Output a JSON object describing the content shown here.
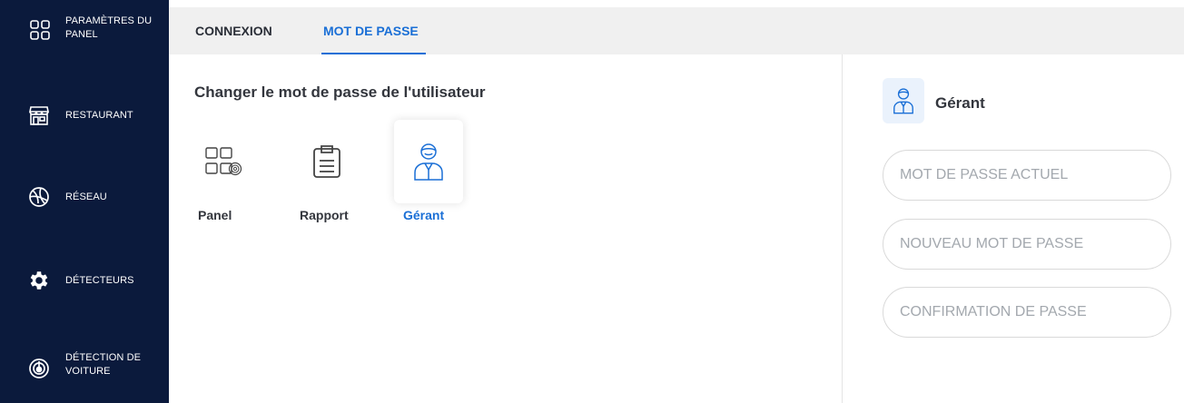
{
  "sidebar": {
    "items": [
      {
        "label": "PARAMÈTRES DU PANEL",
        "icon": "grid-icon"
      },
      {
        "label": "RESTAURANT",
        "icon": "store-icon"
      },
      {
        "label": "RÉSEAU",
        "icon": "globe-icon"
      },
      {
        "label": "DÉTECTEURS",
        "icon": "gear-icon"
      },
      {
        "label": "DÉTECTION DE VOITURE",
        "icon": "radar-icon"
      }
    ]
  },
  "tabs": [
    {
      "label": "CONNEXION",
      "active": false
    },
    {
      "label": "MOT DE PASSE",
      "active": true
    }
  ],
  "main": {
    "title": "Changer le mot de passe de l'utilisateur",
    "options": [
      {
        "label": "Panel",
        "icon": "panel-fingerprint-icon",
        "selected": false
      },
      {
        "label": "Rapport",
        "icon": "clipboard-icon",
        "selected": false
      },
      {
        "label": "Gérant",
        "icon": "manager-icon",
        "selected": true
      }
    ]
  },
  "right": {
    "role": "Gérant",
    "fields": {
      "current_placeholder": "MOT DE PASSE ACTUEL",
      "new_placeholder": "NOUVEAU MOT DE PASSE",
      "confirm_placeholder": "CONFIRMATION DE PASSE"
    }
  },
  "colors": {
    "sidebar_bg": "#0b1a3c",
    "accent": "#1a6fd6",
    "tabbar_bg": "#f0f0f0"
  }
}
